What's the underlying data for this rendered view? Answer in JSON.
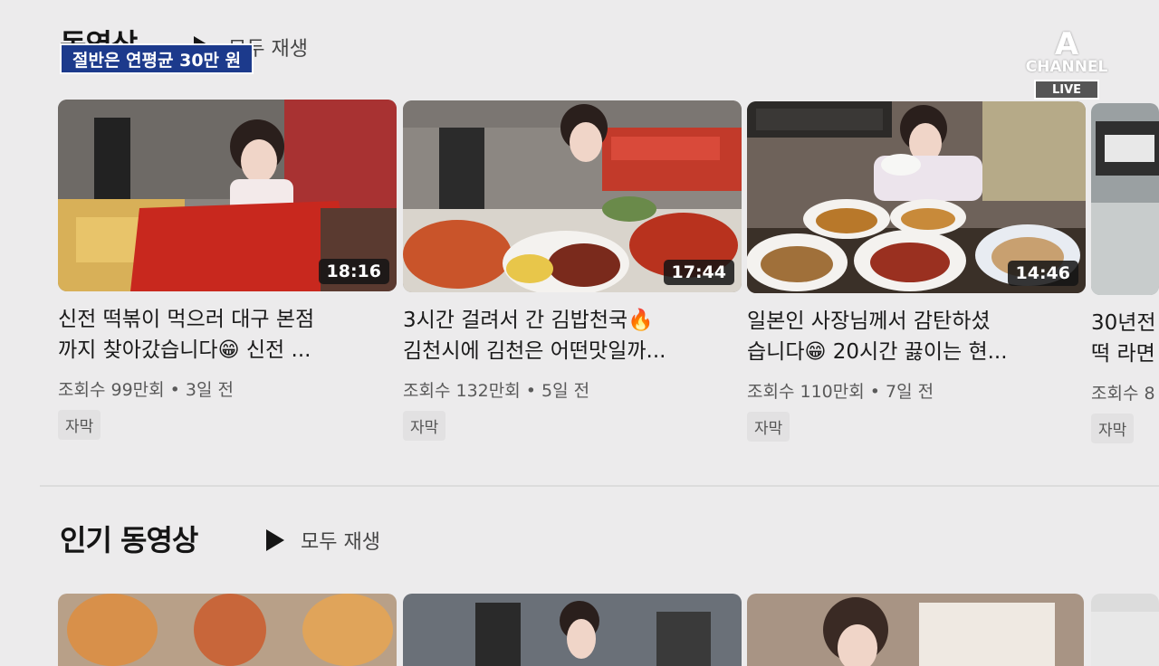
{
  "section1": {
    "title": "동영상",
    "play_all": "모두 재생"
  },
  "news": {
    "banner": "절반은 연평균 30만 원",
    "channel": "CHANNEL",
    "channel_mark": "A",
    "live": "LIVE"
  },
  "videos": [
    {
      "title": "신전 떡볶이 먹으러 대구 본점\n까지 찾아갔습니다😁 신전 ...",
      "views": "조회수 99만회",
      "age": "3일 전",
      "tag": "자막",
      "duration": "18:16"
    },
    {
      "title": "3시간 걸려서 간 김밥천국🔥\n김천시에 김천은 어떤맛일까...",
      "views": "조회수 132만회",
      "age": "5일 전",
      "tag": "자막",
      "duration": "17:44"
    },
    {
      "title": "일본인 사장님께서 감탄하셨\n습니다😁 20시간 끓이는 현...",
      "views": "조회수 110만회",
      "age": "7일 전",
      "tag": "자막",
      "duration": "14:46"
    },
    {
      "title": "30년전\n떡 라면",
      "views": "조회수 8",
      "age": "",
      "tag": "자막",
      "duration": ""
    }
  ],
  "section2": {
    "title": "인기 동영상",
    "play_all": "모두 재생"
  },
  "colors": {
    "banner": "#1c3a8c",
    "background": "#ecebec",
    "sauce": "#c8281e"
  }
}
